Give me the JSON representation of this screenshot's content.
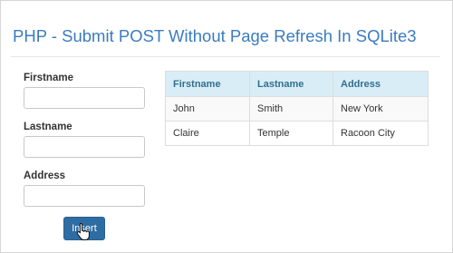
{
  "page": {
    "title": "PHP - Submit POST Without Page Refresh In SQLite3"
  },
  "form": {
    "firstname_label": "Firstname",
    "firstname_value": "",
    "lastname_label": "Lastname",
    "lastname_value": "",
    "address_label": "Address",
    "address_value": "",
    "submit_label": "Insert"
  },
  "table": {
    "headers": [
      "Firstname",
      "Lastname",
      "Address"
    ],
    "rows": [
      [
        "John",
        "Smith",
        "New York"
      ],
      [
        "Claire",
        "Temple",
        "Racoon City"
      ]
    ]
  },
  "colors": {
    "title": "#3a7cc0",
    "header_bg": "#d9edf7",
    "header_text": "#31708f",
    "button_bg": "#2e6da4"
  },
  "icons": {
    "cursor": "hand-pointer-icon"
  }
}
